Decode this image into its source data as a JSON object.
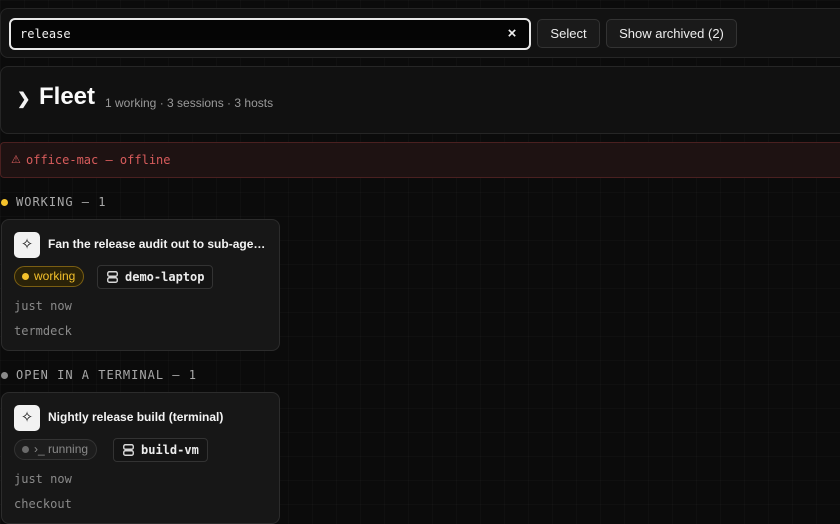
{
  "search": {
    "value": "release",
    "clear_label": "×"
  },
  "toolbar": {
    "select_label": "Select",
    "archived_label": "Show archived (2)"
  },
  "fleet": {
    "chevron": "❯",
    "title": "Fleet",
    "summary": "1 working · 3 sessions · 3 hosts"
  },
  "alert": {
    "icon": "⚠",
    "text": "office-mac — offline"
  },
  "sections": [
    {
      "label": "WORKING — 1",
      "dot_color": "#f5c22b",
      "card": {
        "icon": "sparkle-icon",
        "title": "Fan the release audit out to sub-agents",
        "status": "working",
        "status_color": "#f5c22b",
        "host": "demo-laptop",
        "time": "just now",
        "project": "termdeck"
      }
    },
    {
      "label": "OPEN IN A TERMINAL — 1",
      "dot_color": "#8a8a8a",
      "card": {
        "icon": "sparkle-icon",
        "title": "Nightly release build (terminal)",
        "status": "›_ running",
        "status_color": "#8a8a8a",
        "host": "build-vm",
        "time": "just now",
        "project": "checkout"
      }
    }
  ]
}
